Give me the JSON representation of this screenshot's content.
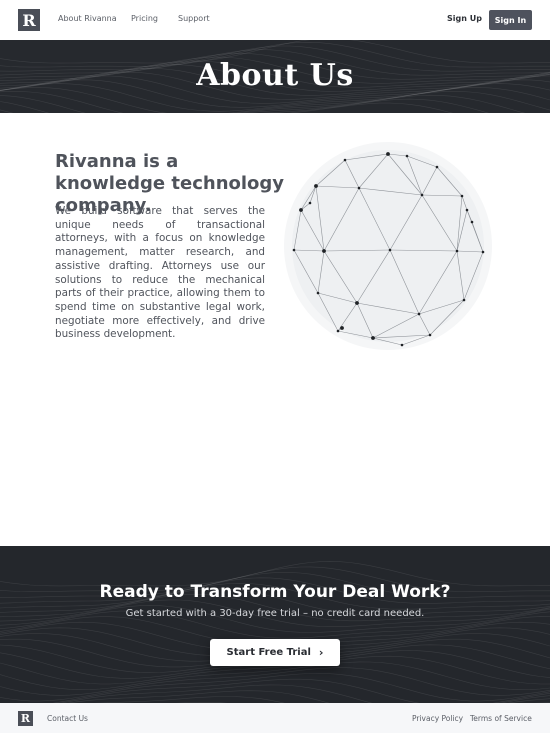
{
  "nav": {
    "logo_letter": "R",
    "links": [
      "About Rivanna",
      "Pricing",
      "Support"
    ],
    "sign_up": "Sign Up",
    "sign_in": "Sign In"
  },
  "hero": {
    "title": "About Us"
  },
  "about": {
    "heading": "Rivanna is a knowledge technology company.",
    "body": "We build software that serves the unique needs of transactional attorneys, with a focus on knowledge management, matter research, and assistive drafting. Attorneys use our solutions to reduce the mechanical parts of their practice, allowing them to spend time on substantive legal work, negotiate more effectively, and drive business development."
  },
  "cta": {
    "title": "Ready to Transform Your Deal Work?",
    "subtitle": "Get started with a 30-day free trial – no credit card needed.",
    "button": "Start Free Trial",
    "button_icon": "chevron-right-icon"
  },
  "footer": {
    "logo_letter": "R",
    "contact": "Contact Us",
    "privacy": "Privacy Policy",
    "terms": "Terms of Service"
  },
  "colors": {
    "dark_band": "#25282d",
    "button_dark": "#4e525d",
    "text": "#4f535b"
  }
}
